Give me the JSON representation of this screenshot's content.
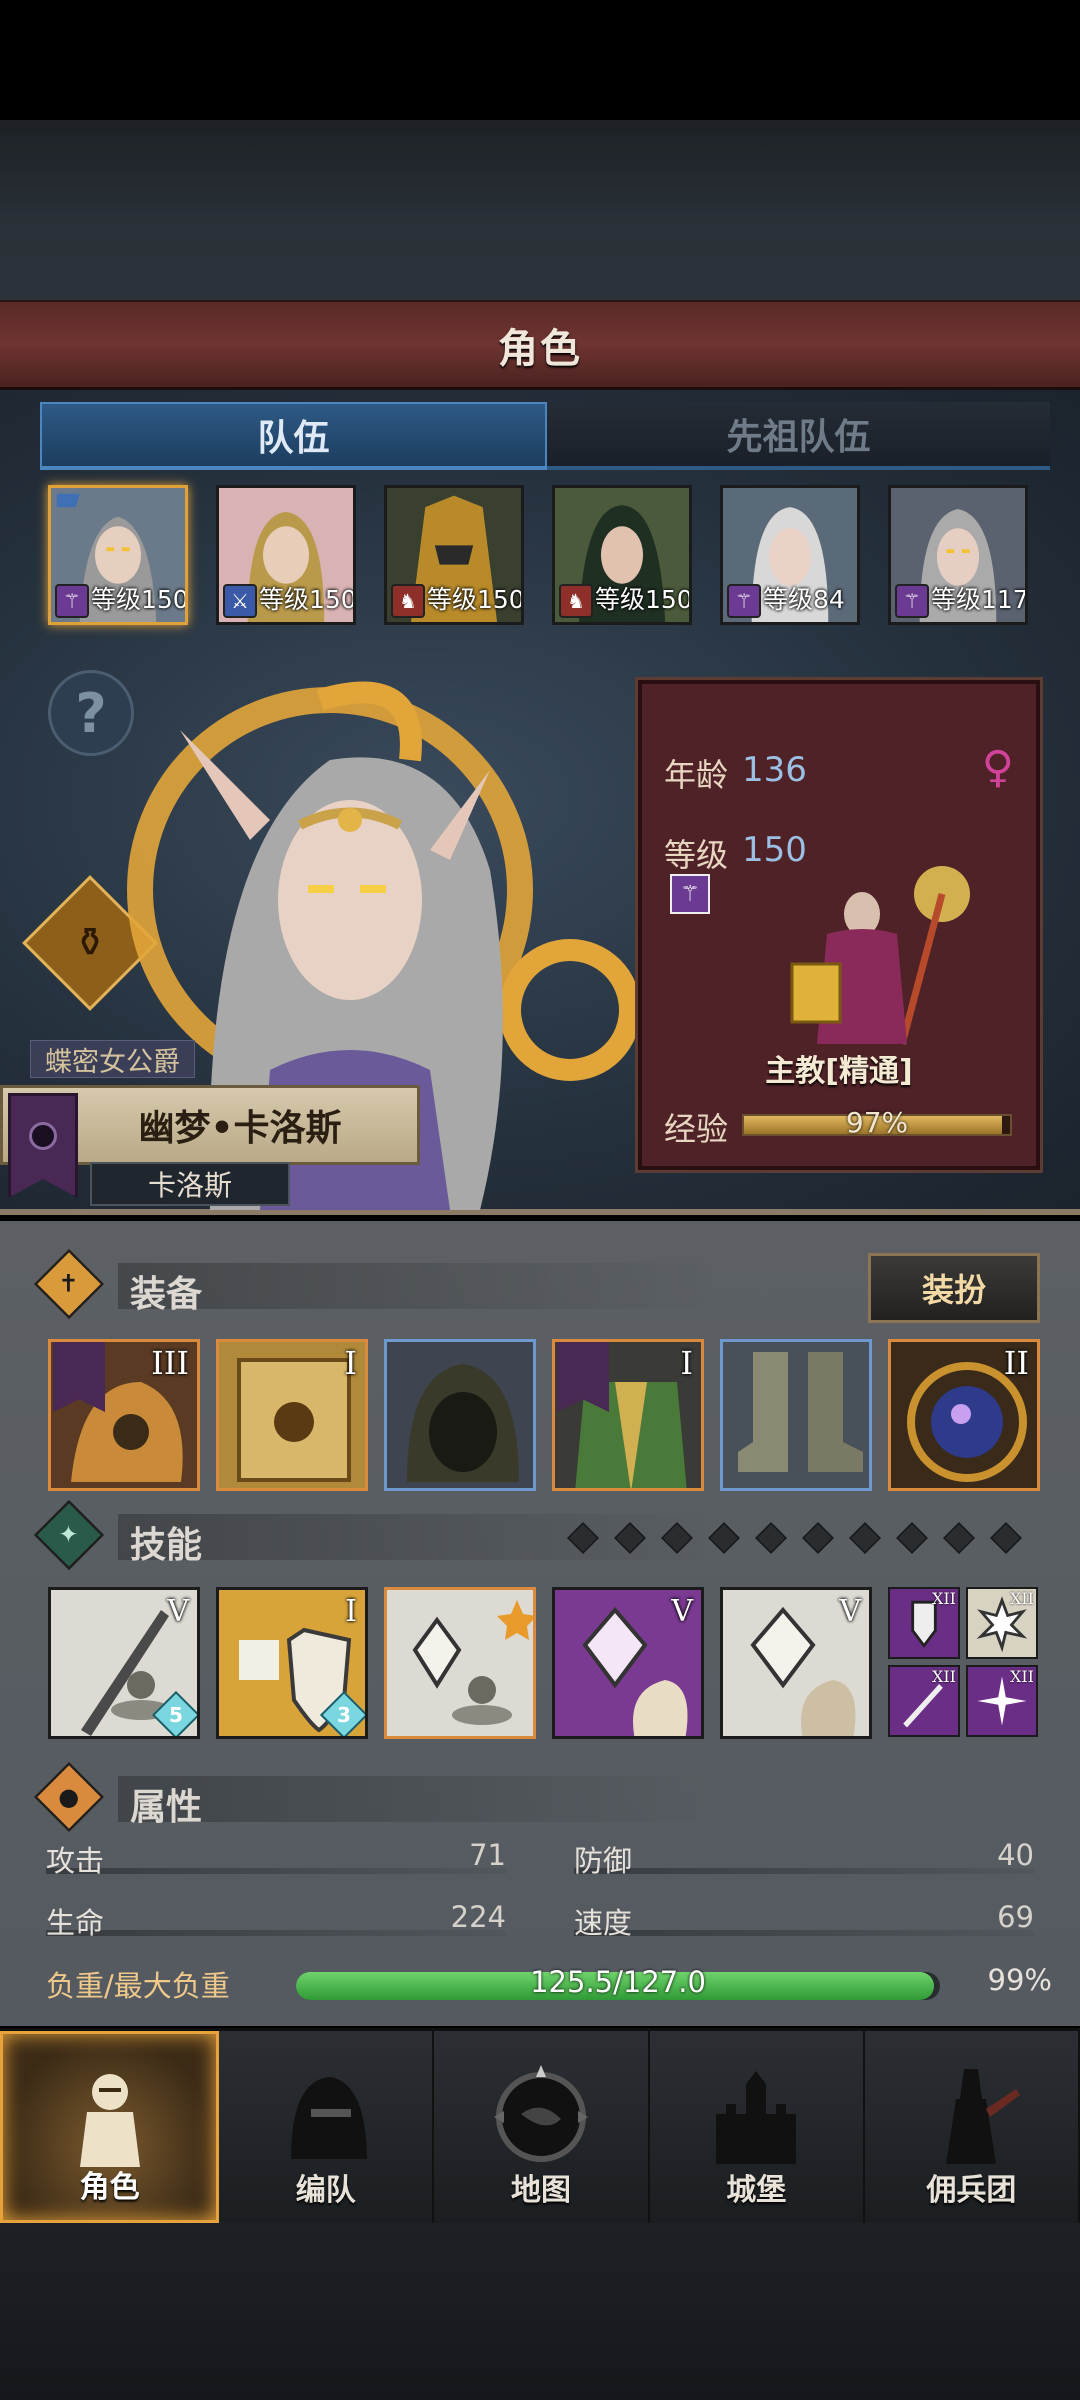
{
  "header": {
    "title": "角色"
  },
  "tabs": [
    {
      "label": "队伍",
      "active": true
    },
    {
      "label": "先祖队伍",
      "active": false
    }
  ],
  "party": [
    {
      "level_label": "等级150",
      "class_icon": "staff-icon",
      "selected": true
    },
    {
      "level_label": "等级150",
      "class_icon": "sword-icon",
      "selected": false
    },
    {
      "level_label": "等级150",
      "class_icon": "horse-icon",
      "selected": false
    },
    {
      "level_label": "等级150",
      "class_icon": "horse-icon",
      "selected": false
    },
    {
      "level_label": "等级84",
      "class_icon": "staff-icon",
      "selected": false
    },
    {
      "level_label": "等级117",
      "class_icon": "staff-icon",
      "selected": false
    }
  ],
  "hero": {
    "title": "蝶密女公爵",
    "name": "幽梦•卡洛斯",
    "house": "卡洛斯"
  },
  "info": {
    "age_label": "年龄",
    "age": "136",
    "level_label": "等级",
    "level": "150",
    "class_name": "主教[精通]",
    "exp_label": "经验",
    "exp_text": "97%",
    "exp_fraction": 0.97
  },
  "equipment": {
    "label": "装备",
    "outfit_button": "装扮",
    "slots": [
      {
        "name": "helmet-slot",
        "roman": "III",
        "flag": true,
        "border": "gold"
      },
      {
        "name": "card-slot",
        "roman": "I",
        "flag": false,
        "border": "gold"
      },
      {
        "name": "hood-slot",
        "roman": "",
        "flag": false,
        "border": "blue"
      },
      {
        "name": "armor-slot",
        "roman": "I",
        "flag": true,
        "border": "gold"
      },
      {
        "name": "boots-slot",
        "roman": "",
        "flag": false,
        "border": "blue"
      },
      {
        "name": "orb-slot",
        "roman": "II",
        "flag": false,
        "border": "gold"
      }
    ]
  },
  "skills": {
    "label": "技能",
    "items": [
      {
        "roman": "V",
        "badge": "5"
      },
      {
        "roman": "I",
        "badge": "3"
      },
      {
        "roman": "",
        "badge": ""
      },
      {
        "roman": "V",
        "badge": ""
      },
      {
        "roman": "V",
        "badge": ""
      }
    ],
    "mini": [
      "XII",
      "XII",
      "XII",
      "XII"
    ]
  },
  "attributes": {
    "label": "属性",
    "attack_label": "攻击",
    "attack": "71",
    "defense_label": "防御",
    "defense": "40",
    "hp_label": "生命",
    "hp": "224",
    "speed_label": "速度",
    "speed": "69",
    "load_label": "负重/最大负重",
    "load_text": "125.5/127.0",
    "load_pct": "99%",
    "load_fraction": 0.99
  },
  "nav": [
    {
      "label": "角色",
      "active": true
    },
    {
      "label": "编队",
      "active": false
    },
    {
      "label": "地图",
      "active": false
    },
    {
      "label": "城堡",
      "active": false
    },
    {
      "label": "佣兵团",
      "active": false
    }
  ],
  "colors": {
    "accent": "#e7a23b",
    "tab_active": "#2e5a86",
    "title_bar": "#6e3431"
  }
}
